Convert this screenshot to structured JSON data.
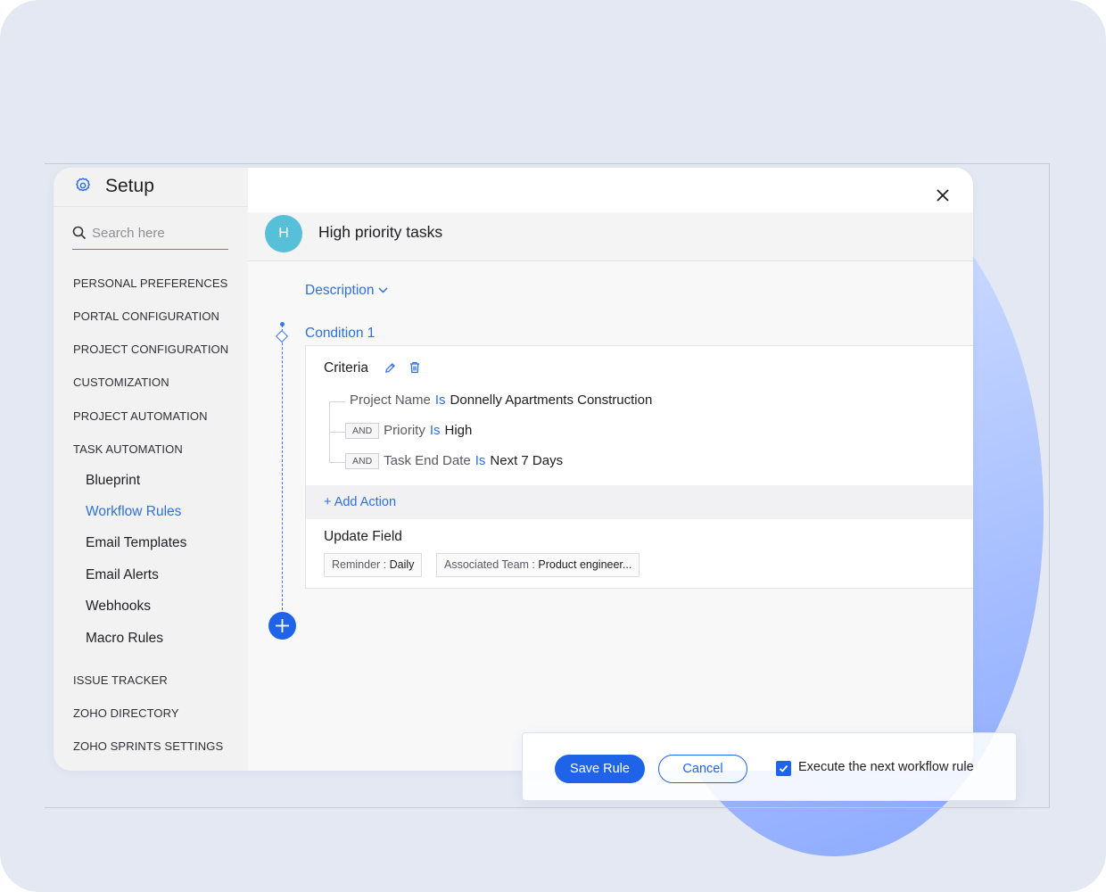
{
  "sidebar": {
    "title": "Setup",
    "search_placeholder": "Search here",
    "sections": [
      "PERSONAL PREFERENCES",
      "PORTAL CONFIGURATION",
      "PROJECT CONFIGURATION",
      "CUSTOMIZATION",
      "PROJECT AUTOMATION",
      "TASK AUTOMATION"
    ],
    "task_automation_items": [
      "Blueprint",
      "Workflow Rules",
      "Email Templates",
      "Email Alerts",
      "Webhooks",
      "Macro Rules"
    ],
    "active_item": "Workflow Rules",
    "bottom_sections": [
      "ISSUE TRACKER",
      "ZOHO DIRECTORY",
      "ZOHO SPRINTS SETTINGS"
    ]
  },
  "rule": {
    "avatar_letter": "H",
    "title": "High priority tasks",
    "description_label": "Description",
    "condition_label": "Condition 1",
    "criteria_title": "Criteria",
    "criteria": [
      {
        "connector": "",
        "field": "Project Name",
        "operator": "Is",
        "value": "Donnelly Apartments Construction"
      },
      {
        "connector": "AND",
        "field": "Priority",
        "operator": "Is",
        "value": "High"
      },
      {
        "connector": "AND",
        "field": "Task End Date",
        "operator": "Is",
        "value": "Next 7 Days"
      }
    ],
    "add_action_label": "+ Add Action",
    "update_field_title": "Update Field",
    "update_fields": [
      {
        "key": "Reminder :",
        "value": "Daily"
      },
      {
        "key": "Associated Team :",
        "value": "Product engineer..."
      }
    ]
  },
  "footer": {
    "save_label": "Save Rule",
    "cancel_label": "Cancel",
    "execute_next_label": "Execute the next workflow rule",
    "execute_next_checked": true
  },
  "colors": {
    "accent": "#1f64e8",
    "link": "#2f6fe0",
    "avatar": "#57bfd8",
    "backdrop": "#e4e8f2"
  }
}
